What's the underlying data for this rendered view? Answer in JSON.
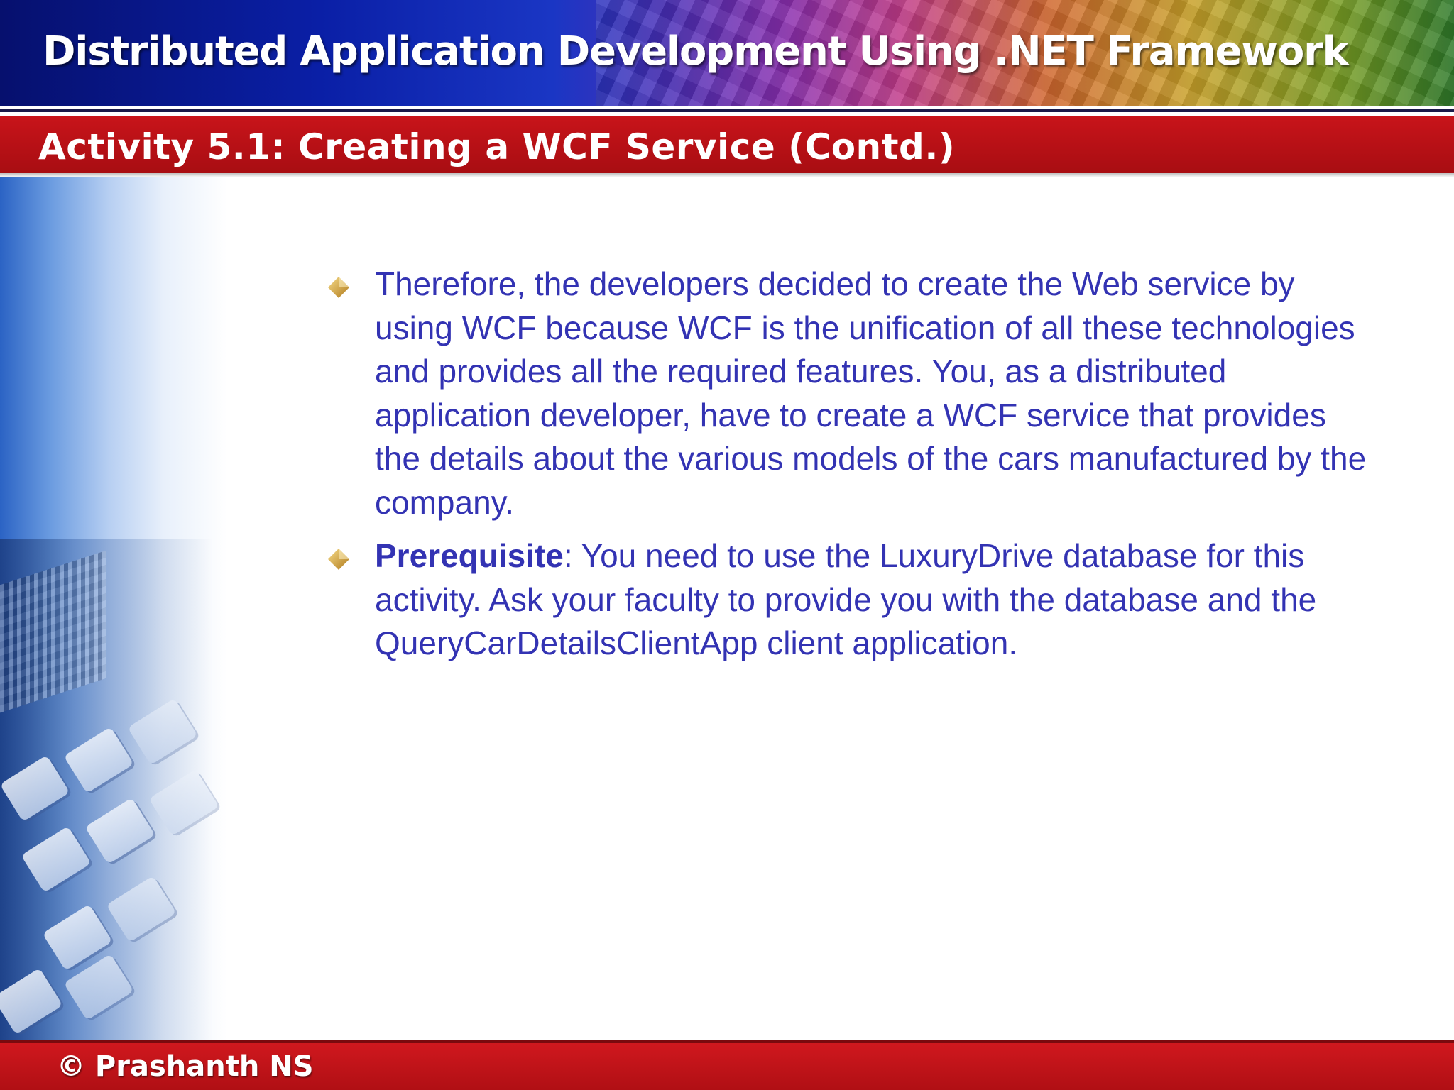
{
  "header": {
    "title": "Distributed Application Development Using .NET Framework"
  },
  "slide": {
    "subtitle": "Activity 5.1: Creating a WCF Service (Contd.)",
    "bullets": [
      {
        "text": "Therefore, the developers decided to create the Web service by using WCF because WCF is the unification of all these technologies and provides all the required features. You, as a distributed application developer, have to create a WCF service that provides the details about the various models of the cars manufactured by the company."
      },
      {
        "bold": "Prerequisite",
        "text": ": You need to use the LuxuryDrive database for this activity. Ask your faculty to provide you with the database and the QueryCarDetailsClientApp client application."
      }
    ],
    "bullet_icon": "diamond-bullet-icon"
  },
  "footer": {
    "copyright": "© Prashanth NS"
  },
  "colors": {
    "body_text": "#3333b3",
    "subtitle_band": "#c8141a",
    "header_band": "#0a1fa6",
    "footer_band": "#d0181e"
  }
}
